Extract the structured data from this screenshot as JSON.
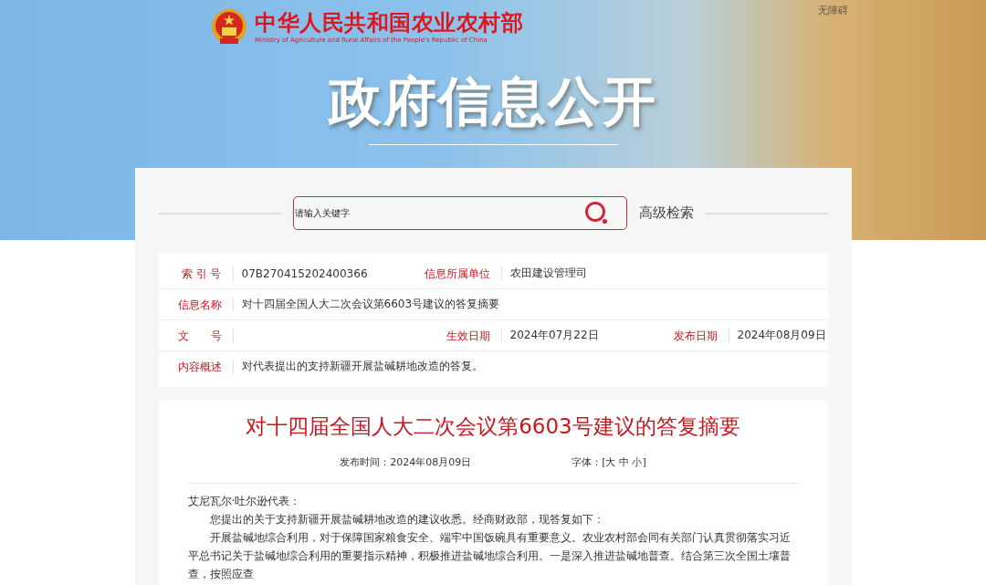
{
  "header": {
    "ministry_name_cn": "中华人民共和国农业农村部",
    "ministry_name_en": "Ministry of Agriculture and Rural Affairs of the People's Republic of China",
    "accessibility_link": "无障碍",
    "banner_title": "政府信息公开"
  },
  "search": {
    "placeholder": "请输入关键字",
    "advanced_link": "高级检索"
  },
  "info_table": {
    "rows": [
      {
        "fields": [
          {
            "label": "索 引 号",
            "value": "07B270415202400366"
          },
          {
            "label": "信息所属单位",
            "value": "农田建设管理司"
          }
        ]
      },
      {
        "fields": [
          {
            "label": "信息名称",
            "value": "对十四届全国人大二次会议第6603号建议的答复摘要"
          }
        ]
      },
      {
        "fields": [
          {
            "label": "文　　号"
          },
          {
            "label": "生效日期",
            "value": "2024年07月22日"
          },
          {
            "label": "发布日期",
            "value": "2024年08月09日"
          }
        ]
      },
      {
        "fields": [
          {
            "label": "内容概述",
            "value": "对代表提出的支持新疆开展盐碱耕地改造的答复。"
          }
        ]
      }
    ]
  },
  "article": {
    "title": "对十四届全国人大二次会议第6603号建议的答复摘要",
    "publish_time": "发布时间：2024年08月09日",
    "font_size_control": "字体：[大 中 小]",
    "paragraphs": [
      {
        "kind": "salutation",
        "text": "艾尼瓦尔·吐尔逊代表："
      },
      {
        "kind": "body",
        "text": "您提出的关于支持新疆开展盐碱耕地改造的建议收悉。经商财政部，现答复如下："
      },
      {
        "kind": "body",
        "text": "开展盐碱地综合利用，对于保障国家粮食安全、端牢中国饭碗具有重要意义。农业农村部会同有关部门认真贯彻落实习近平总书记关于盐碱地综合利用的重要指示精神，积极推进盐碱地综合利用。一是深入推进盐碱地普查。结合第三次全国土壤普查，按照应查"
      }
    ]
  }
}
